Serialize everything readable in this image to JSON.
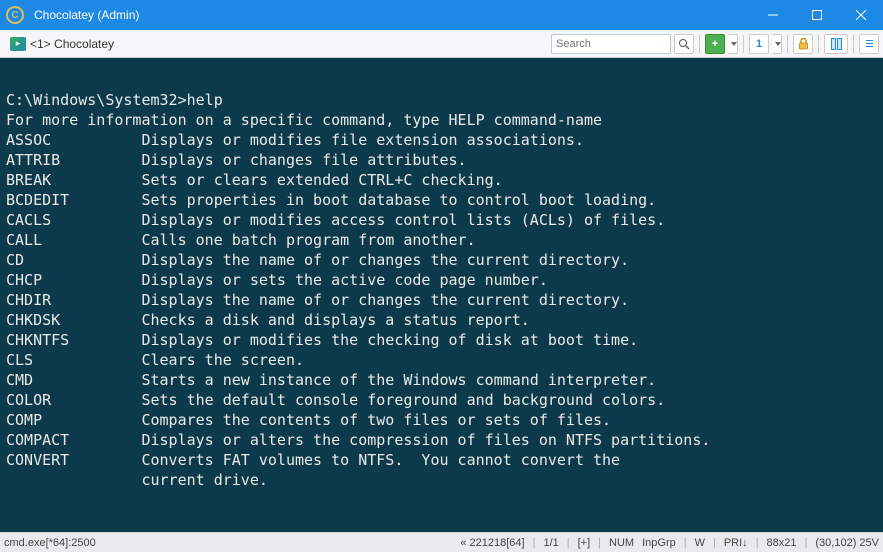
{
  "window": {
    "title": "Chocolatey (Admin)"
  },
  "toolbar": {
    "tab_label": "<1> Chocolatey",
    "search_placeholder": "Search",
    "num_button": "1"
  },
  "terminal": {
    "prompt": "C:\\Windows\\System32>",
    "command": "help",
    "intro": "For more information on a specific command, type HELP command-name",
    "entries": [
      {
        "cmd": "ASSOC",
        "desc": "Displays or modifies file extension associations."
      },
      {
        "cmd": "ATTRIB",
        "desc": "Displays or changes file attributes."
      },
      {
        "cmd": "BREAK",
        "desc": "Sets or clears extended CTRL+C checking."
      },
      {
        "cmd": "BCDEDIT",
        "desc": "Sets properties in boot database to control boot loading."
      },
      {
        "cmd": "CACLS",
        "desc": "Displays or modifies access control lists (ACLs) of files."
      },
      {
        "cmd": "CALL",
        "desc": "Calls one batch program from another."
      },
      {
        "cmd": "CD",
        "desc": "Displays the name of or changes the current directory."
      },
      {
        "cmd": "CHCP",
        "desc": "Displays or sets the active code page number."
      },
      {
        "cmd": "CHDIR",
        "desc": "Displays the name of or changes the current directory."
      },
      {
        "cmd": "CHKDSK",
        "desc": "Checks a disk and displays a status report."
      },
      {
        "cmd": "CHKNTFS",
        "desc": "Displays or modifies the checking of disk at boot time."
      },
      {
        "cmd": "CLS",
        "desc": "Clears the screen."
      },
      {
        "cmd": "CMD",
        "desc": "Starts a new instance of the Windows command interpreter."
      },
      {
        "cmd": "COLOR",
        "desc": "Sets the default console foreground and background colors."
      },
      {
        "cmd": "COMP",
        "desc": "Compares the contents of two files or sets of files."
      },
      {
        "cmd": "COMPACT",
        "desc": "Displays or alters the compression of files on NTFS partitions."
      },
      {
        "cmd": "CONVERT",
        "desc": "Converts FAT volumes to NTFS.  You cannot convert the"
      }
    ],
    "continuation": "current drive."
  },
  "status": {
    "left": "cmd.exe[*64]:2500",
    "center1": "« 221218[64]",
    "center2": "1/1",
    "center3": "[+]",
    "num": "NUM",
    "inpgrp": "InpGrp",
    "w": "W",
    "pri": "PRI↓",
    "size": "88x21",
    "pos": "(30,102) 25V"
  }
}
